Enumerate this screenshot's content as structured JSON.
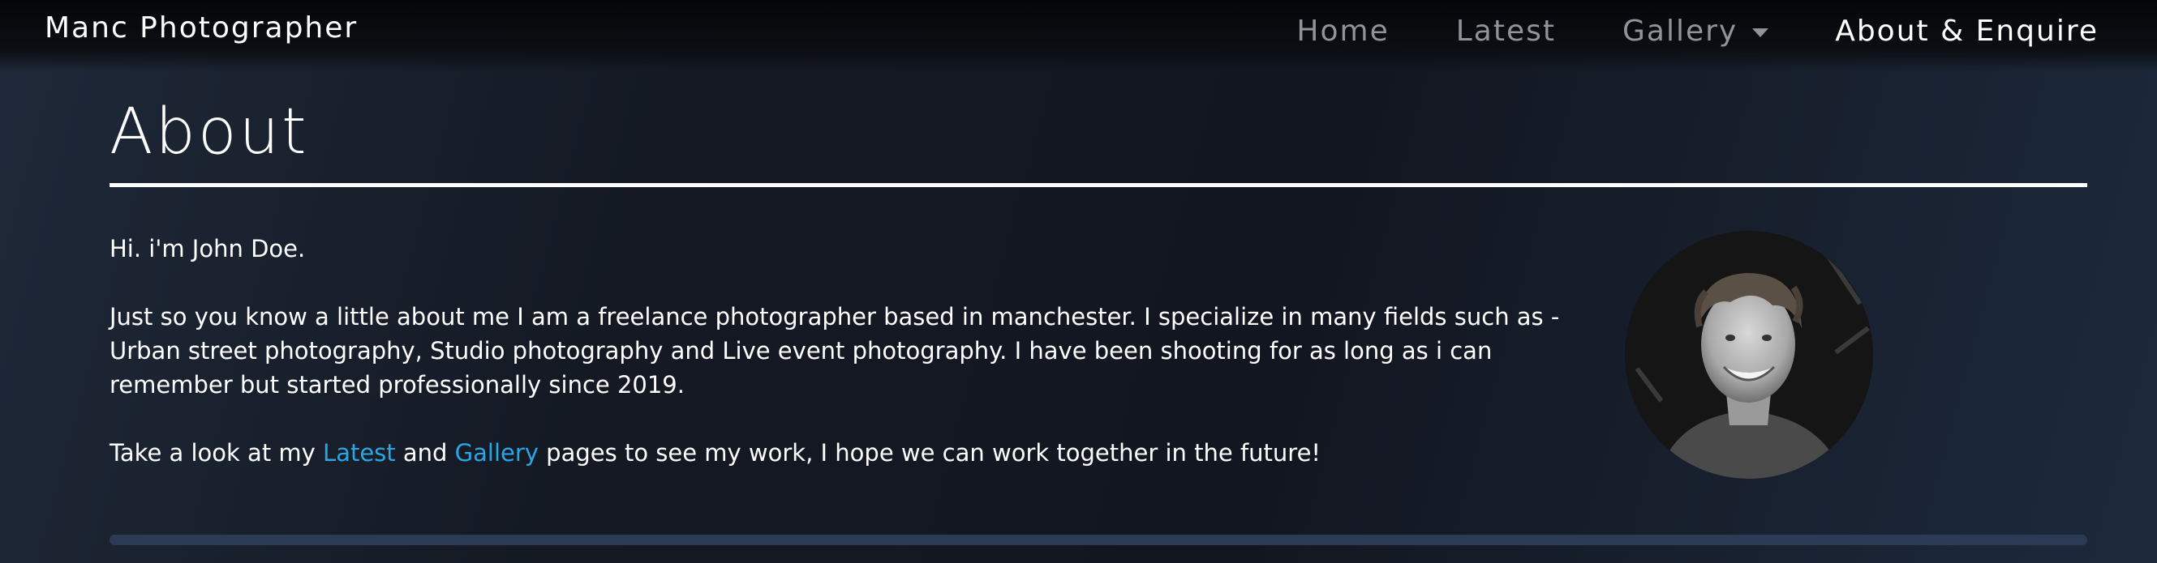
{
  "brand": {
    "name": "Manc Photographer"
  },
  "nav": {
    "items": [
      {
        "label": "Home"
      },
      {
        "label": "Latest"
      },
      {
        "label": "Gallery"
      },
      {
        "label": "About & Enquire"
      }
    ]
  },
  "page": {
    "title": "About",
    "intro": "Hi. i'm John Doe.",
    "bio": "Just so you know a little about me I am a freelance photographer based in manchester. I specialize in many fields such as - Urban street photography, Studio photography and Live event photography. I have been shooting for as long as i can remember but started professionally since 2019.",
    "cta": {
      "prefix": "Take a look at my ",
      "link1": "Latest",
      "middle": " and ",
      "link2": "Gallery",
      "suffix": " pages to see my work, I hope we can work together in the future!"
    }
  },
  "colors": {
    "link": "#27a7e8",
    "accent_bar": "#2c3b55"
  },
  "icons": {
    "gallery_dropdown": "caret-down-icon"
  }
}
